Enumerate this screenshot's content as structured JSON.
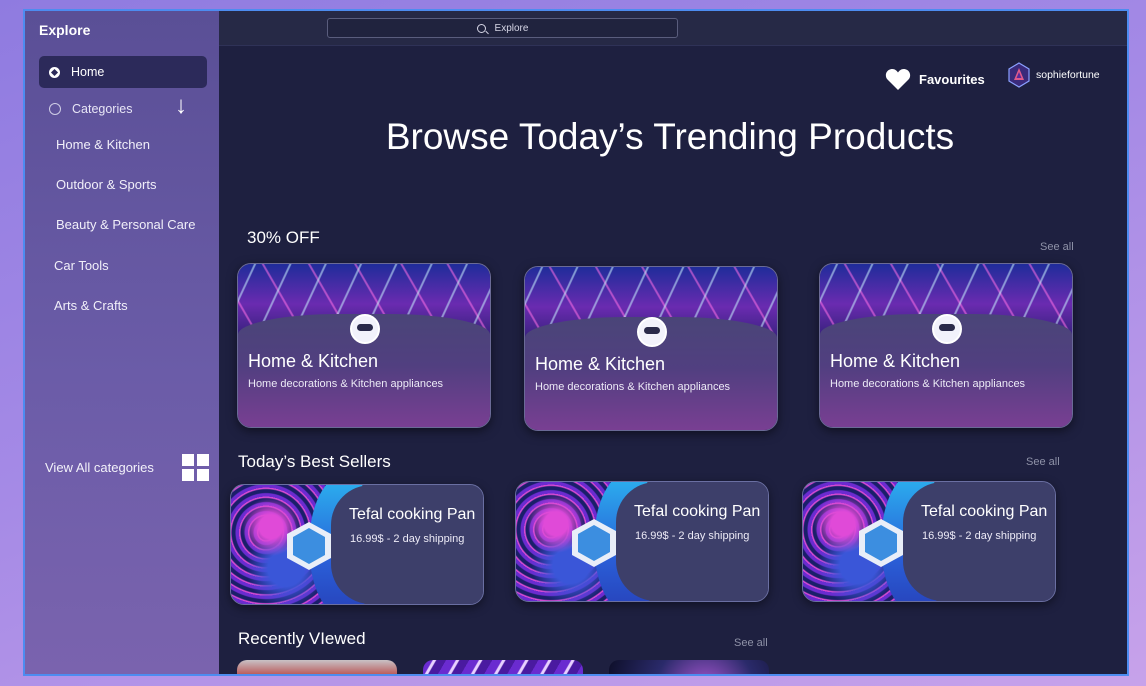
{
  "app": {
    "title": "Explore"
  },
  "search": {
    "placeholder": "Explore"
  },
  "sidebar": {
    "home_label": "Home",
    "categories_label": "Categories",
    "items": [
      "Home & Kitchen",
      "Outdoor & Sports",
      "Beauty & Personal Care",
      "Car Tools",
      "Arts & Crafts"
    ],
    "view_all_label": "View All categories"
  },
  "header": {
    "favourites_label": "Favourites",
    "username": "sophiefortune"
  },
  "hero": {
    "title": "Browse Today’s Trending Products"
  },
  "sections": {
    "promo": {
      "title": "30% OFF",
      "see_all": "See all",
      "cards": [
        {
          "title": "Home & Kitchen",
          "subtitle": "Home decorations & Kitchen appliances"
        },
        {
          "title": "Home & Kitchen",
          "subtitle": "Home decorations & Kitchen appliances"
        },
        {
          "title": "Home & Kitchen",
          "subtitle": "Home decorations & Kitchen appliances"
        }
      ]
    },
    "best_sellers": {
      "title": "Today’s Best Sellers",
      "see_all": "See all",
      "cards": [
        {
          "title": "Tefal cooking Pan",
          "subtitle": "16.99$  - 2 day shipping"
        },
        {
          "title": "Tefal cooking Pan",
          "subtitle": "16.99$  - 2 day shipping"
        },
        {
          "title": "Tefal cooking Pan",
          "subtitle": "16.99$  - 2 day shipping"
        }
      ]
    },
    "recently_viewed": {
      "title": "Recently VIewed",
      "see_all": "See all"
    }
  },
  "colors": {
    "sidebar": "#5a4f96",
    "main_bg": "#1e2040",
    "accent_border": "#4d8cf0"
  }
}
